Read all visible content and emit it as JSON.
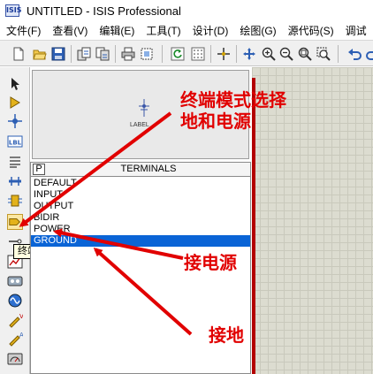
{
  "window": {
    "app_icon_text": "ISIS",
    "title": "UNTITLED - ISIS Professional"
  },
  "menu": [
    {
      "id": "file",
      "label": "文件(F)"
    },
    {
      "id": "view",
      "label": "查看(V)"
    },
    {
      "id": "edit",
      "label": "编辑(E)"
    },
    {
      "id": "tools",
      "label": "工具(T)"
    },
    {
      "id": "design",
      "label": "设计(D)"
    },
    {
      "id": "graph",
      "label": "绘图(G)"
    },
    {
      "id": "source",
      "label": "源代码(S)"
    },
    {
      "id": "debug",
      "label": "调试"
    }
  ],
  "preview": {
    "label": "LABEL"
  },
  "device_panel": {
    "p_button": "P",
    "title": "TERMINALS",
    "items": [
      "DEFAULT",
      "INPUT",
      "OUTPUT",
      "BIDIR",
      "POWER",
      "GROUND"
    ],
    "selected": "GROUND"
  },
  "tooltip": {
    "text": "终端模式"
  },
  "annotations": {
    "mode_line1": "终端模式选择",
    "mode_line2": "地和电源",
    "power": "接电源",
    "ground": "接地"
  },
  "colors": {
    "annotation": "#e10000",
    "selection": "#0a64d6",
    "sheet_border": "#b30000"
  }
}
